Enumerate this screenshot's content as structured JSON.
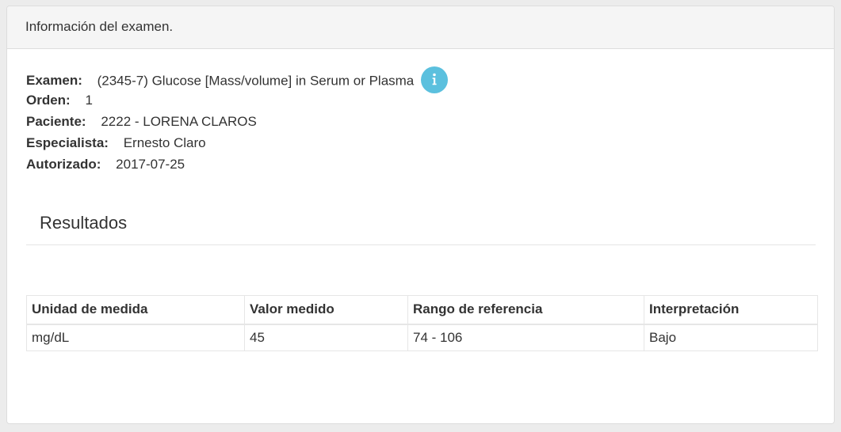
{
  "panel": {
    "heading": "Información del examen."
  },
  "info": {
    "examen": {
      "label": "Examen:",
      "value": "(2345-7) Glucose [Mass/volume] in Serum or Plasma",
      "icon": "info-icon",
      "icon_color": "#5bc0de"
    },
    "orden": {
      "label": "Orden:",
      "value": "1"
    },
    "paciente": {
      "label": "Paciente:",
      "value": "2222 - LORENA CLAROS"
    },
    "especialista": {
      "label": "Especialista:",
      "value": "Ernesto Claro"
    },
    "autorizado": {
      "label": "Autorizado:",
      "value": "2017-07-25"
    }
  },
  "results": {
    "title": "Resultados",
    "columns": [
      "Unidad de medida",
      "Valor medido",
      "Rango de referencia",
      "Interpretación"
    ],
    "rows": [
      [
        "mg/dL",
        "45",
        "74 - 106",
        "Bajo"
      ]
    ]
  }
}
